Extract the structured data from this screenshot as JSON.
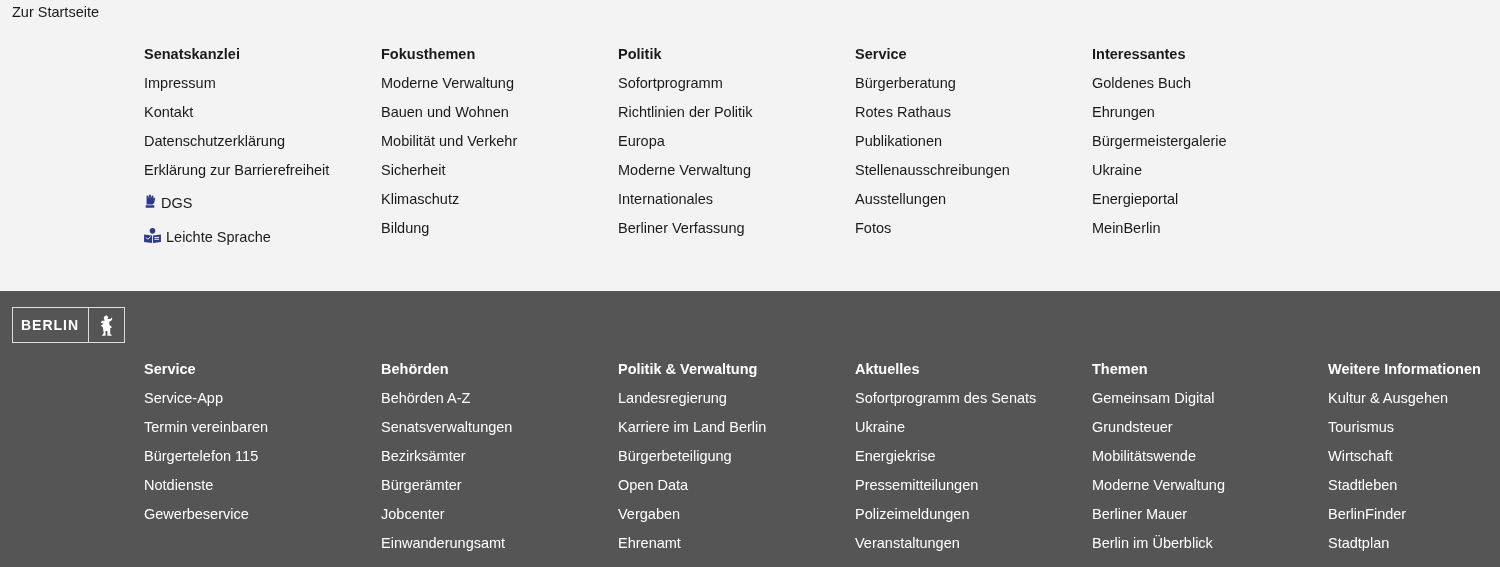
{
  "home_link": "Zur Startseite",
  "top_columns": [
    {
      "heading": "Senatskanzlei",
      "items": [
        {
          "kind": "text",
          "label": "Impressum"
        },
        {
          "kind": "text",
          "label": "Kontakt"
        },
        {
          "kind": "text",
          "label": "Datenschutzerklärung"
        },
        {
          "kind": "text",
          "label": "Erklärung zur Barrierefreiheit"
        },
        {
          "kind": "sign",
          "label": "DGS"
        },
        {
          "kind": "reader",
          "label": "Leichte Sprache"
        }
      ]
    },
    {
      "heading": "Fokusthemen",
      "items": [
        {
          "kind": "text",
          "label": "Moderne Verwaltung"
        },
        {
          "kind": "text",
          "label": "Bauen und Wohnen"
        },
        {
          "kind": "text",
          "label": "Mobilität und Verkehr"
        },
        {
          "kind": "text",
          "label": "Sicherheit"
        },
        {
          "kind": "text",
          "label": "Klimaschutz"
        },
        {
          "kind": "text",
          "label": "Bildung"
        }
      ]
    },
    {
      "heading": "Politik",
      "items": [
        {
          "kind": "text",
          "label": "Sofortprogramm"
        },
        {
          "kind": "text",
          "label": "Richtlinien der Politik"
        },
        {
          "kind": "text",
          "label": "Europa"
        },
        {
          "kind": "text",
          "label": "Moderne Verwaltung"
        },
        {
          "kind": "text",
          "label": "Internationales"
        },
        {
          "kind": "text",
          "label": "Berliner Verfassung"
        }
      ]
    },
    {
      "heading": "Service",
      "items": [
        {
          "kind": "text",
          "label": "Bürgerberatung"
        },
        {
          "kind": "text",
          "label": "Rotes Rathaus"
        },
        {
          "kind": "text",
          "label": "Publikationen"
        },
        {
          "kind": "text",
          "label": "Stellenausschreibungen"
        },
        {
          "kind": "text",
          "label": "Ausstellungen"
        },
        {
          "kind": "text",
          "label": "Fotos"
        }
      ]
    },
    {
      "heading": "Interessantes",
      "items": [
        {
          "kind": "text",
          "label": "Goldenes Buch"
        },
        {
          "kind": "text",
          "label": "Ehrungen"
        },
        {
          "kind": "text",
          "label": "Bürgermeistergalerie"
        },
        {
          "kind": "text",
          "label": "Ukraine"
        },
        {
          "kind": "text",
          "label": "Energieportal"
        },
        {
          "kind": "text",
          "label": "MeinBerlin"
        }
      ]
    }
  ],
  "logo": {
    "text": "BERLIN"
  },
  "bottom_columns": [
    {
      "heading": "Service",
      "items": [
        "Service-App",
        "Termin vereinbaren",
        "Bürgertelefon 115",
        "Notdienste",
        "Gewerbeservice"
      ]
    },
    {
      "heading": "Behörden",
      "items": [
        "Behörden A-Z",
        "Senatsverwaltungen",
        "Bezirksämter",
        "Bürgerämter",
        "Jobcenter",
        "Einwanderungsamt"
      ]
    },
    {
      "heading": "Politik & Verwaltung",
      "items": [
        "Landesregierung",
        "Karriere im Land Berlin",
        "Bürgerbeteiligung",
        "Open Data",
        "Vergaben",
        "Ehrenamt"
      ]
    },
    {
      "heading": "Aktuelles",
      "items": [
        "Sofortprogramm des Senats",
        "Ukraine",
        "Energiekrise",
        "Pressemitteilungen",
        "Polizeimeldungen",
        "Veranstaltungen"
      ]
    },
    {
      "heading": "Themen",
      "items": [
        "Gemeinsam Digital",
        "Grundsteuer",
        "Mobilitätswende",
        "Moderne Verwaltung",
        "Berliner Mauer",
        "Berlin im Überblick"
      ]
    },
    {
      "heading": "Weitere Informationen",
      "items": [
        "Kultur & Ausgehen",
        "Tourismus",
        "Wirtschaft",
        "Stadtleben",
        "BerlinFinder",
        "Stadtplan"
      ]
    }
  ]
}
